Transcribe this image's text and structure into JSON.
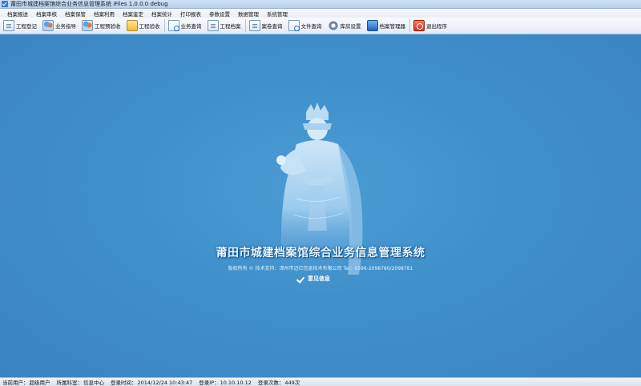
{
  "window": {
    "title": "莆田市城建档案馆综合业务信息管理系统   iFiles  1.0.0.0 debug"
  },
  "menu": [
    "档案报送",
    "档案审核",
    "档案保管",
    "档案利用",
    "档案鉴定",
    "档案统计",
    "打印报表",
    "参数设置",
    "数据管理",
    "系统管理"
  ],
  "toolbar": [
    {
      "label": "工程登记",
      "icon": "pen-doc-icon"
    },
    {
      "label": "业务指导",
      "icon": "people-icon"
    },
    {
      "label": "工程预验收",
      "icon": "inspect-icon"
    },
    {
      "label": "工程验收",
      "icon": "folder-icon"
    },
    {
      "label": "业务查询",
      "icon": "search-doc-icon"
    },
    {
      "label": "工程档案",
      "icon": "archive-doc-icon"
    },
    {
      "label": "案卷查询",
      "icon": "binder-icon"
    },
    {
      "label": "文件查询",
      "icon": "file-search-icon"
    },
    {
      "label": "库房设置",
      "icon": "gear-icon"
    },
    {
      "label": "档案管理器",
      "icon": "archive-manager-icon"
    },
    {
      "label": "退出程序",
      "icon": "exit-icon"
    }
  ],
  "main": {
    "heading": "莆田市城建档案馆综合业务信息管理系统",
    "copyright": "版权所有 © 技术支持：漳州市迈亿信息技术有限公司  Tel：0596-2098780/2098781",
    "feedback_link": "意见信息"
  },
  "status": [
    {
      "label": "当前用户：",
      "value": "超级用户"
    },
    {
      "label": "所属科室：",
      "value": "信息中心"
    },
    {
      "label": "登录时间：",
      "value": "2014/12/24 10:43:47"
    },
    {
      "label": "登录IP：",
      "value": "10.10.10.12"
    },
    {
      "label": "登录次数：",
      "value": "449次"
    }
  ]
}
